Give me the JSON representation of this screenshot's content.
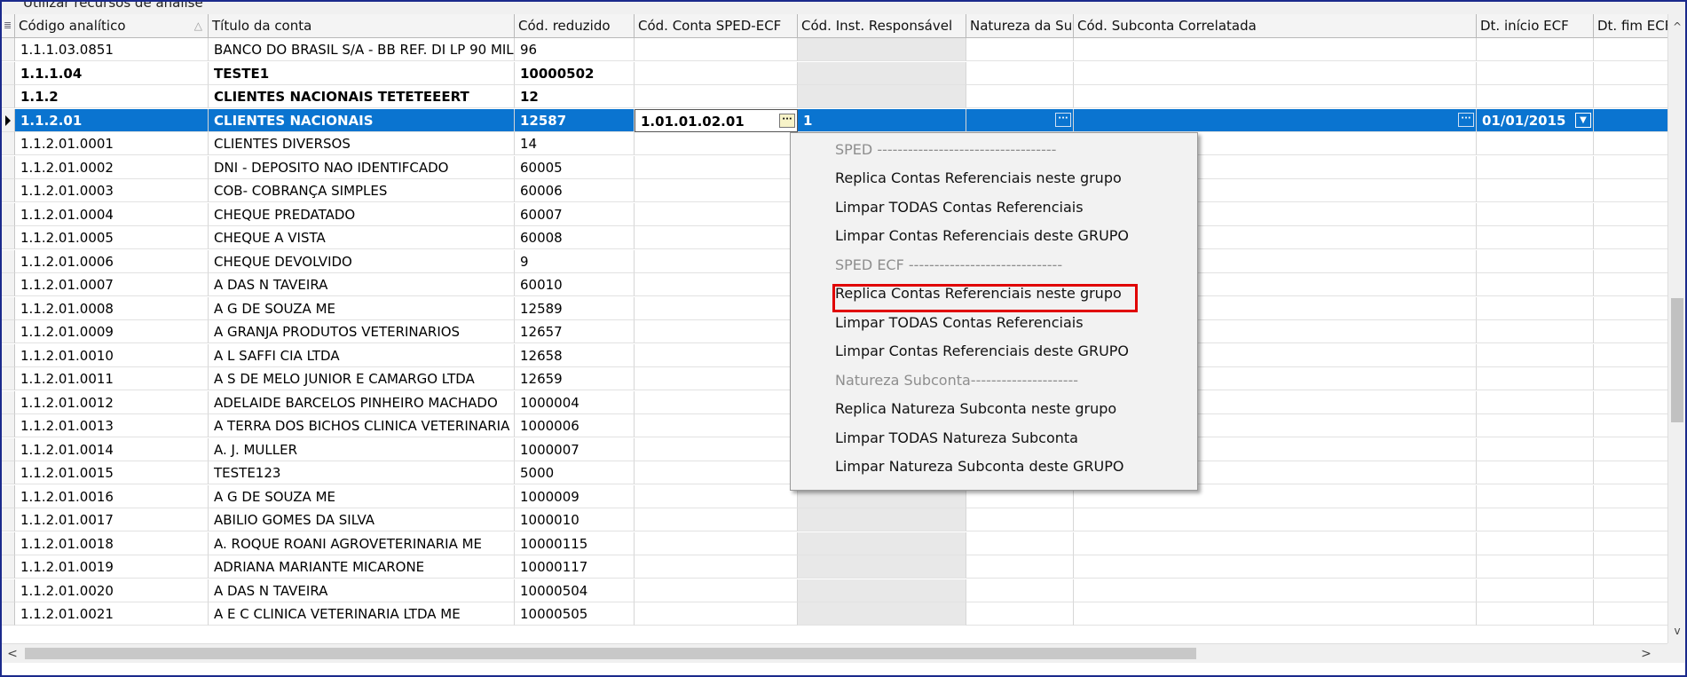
{
  "top_strip_label": "Utilizar recursos de análise",
  "columns": [
    {
      "label": "Código analítico"
    },
    {
      "label": "Título da conta"
    },
    {
      "label": "Cód. reduzido"
    },
    {
      "label": "Cód. Conta SPED-ECF"
    },
    {
      "label": "Cód. Inst. Responsável"
    },
    {
      "label": "Natureza da Su"
    },
    {
      "label": "Cód. Subconta Correlatada"
    },
    {
      "label": "Dt. início ECF"
    },
    {
      "label": "Dt. fim ECF"
    }
  ],
  "rows": [
    {
      "codigo": "1.1.1.03.0851",
      "titulo": "BANCO DO BRASIL S/A - BB REF. DI LP 90 MIL",
      "reduzido": "96",
      "style": "normal"
    },
    {
      "codigo": "1.1.1.04",
      "titulo": "TESTE1",
      "reduzido": "10000502",
      "style": "bold"
    },
    {
      "codigo": "1.1.2",
      "titulo": "CLIENTES NACIONAIS TETETEEERT",
      "reduzido": "12",
      "style": "bold"
    },
    {
      "codigo": "1.1.2.01",
      "titulo": "CLIENTES NACIONAIS",
      "reduzido": "12587",
      "sped": "1.01.01.02.01",
      "inst": "1",
      "dt_inicio": "01/01/2015",
      "style": "selected"
    },
    {
      "codigo": "1.1.2.01.0001",
      "titulo": "CLIENTES DIVERSOS",
      "reduzido": "14",
      "style": "normal"
    },
    {
      "codigo": "1.1.2.01.0002",
      "titulo": "DNI - DEPOSITO NAO IDENTIFCADO",
      "reduzido": "60005",
      "style": "normal"
    },
    {
      "codigo": "1.1.2.01.0003",
      "titulo": "COB- COBRANÇA SIMPLES",
      "reduzido": "60006",
      "style": "normal"
    },
    {
      "codigo": "1.1.2.01.0004",
      "titulo": "CHEQUE PREDATADO",
      "reduzido": "60007",
      "style": "normal"
    },
    {
      "codigo": "1.1.2.01.0005",
      "titulo": "CHEQUE A VISTA",
      "reduzido": "60008",
      "style": "normal"
    },
    {
      "codigo": "1.1.2.01.0006",
      "titulo": "CHEQUE DEVOLVIDO",
      "reduzido": "9",
      "style": "normal"
    },
    {
      "codigo": "1.1.2.01.0007",
      "titulo": "A DAS N TAVEIRA",
      "reduzido": "60010",
      "style": "normal"
    },
    {
      "codigo": "1.1.2.01.0008",
      "titulo": "A G DE SOUZA ME",
      "reduzido": "12589",
      "style": "normal"
    },
    {
      "codigo": "1.1.2.01.0009",
      "titulo": "A GRANJA PRODUTOS VETERINARIOS",
      "reduzido": "12657",
      "style": "normal"
    },
    {
      "codigo": "1.1.2.01.0010",
      "titulo": "A L SAFFI CIA LTDA",
      "reduzido": "12658",
      "style": "normal"
    },
    {
      "codigo": "1.1.2.01.0011",
      "titulo": "A S DE MELO JUNIOR E CAMARGO LTDA",
      "reduzido": "12659",
      "style": "normal"
    },
    {
      "codigo": "1.1.2.01.0012",
      "titulo": "ADELAIDE BARCELOS PINHEIRO MACHADO",
      "reduzido": "1000004",
      "style": "normal"
    },
    {
      "codigo": "1.1.2.01.0013",
      "titulo": "A TERRA DOS BICHOS CLINICA VETERINARIA",
      "reduzido": "1000006",
      "style": "normal"
    },
    {
      "codigo": "1.1.2.01.0014",
      "titulo": "A. J. MULLER",
      "reduzido": "1000007",
      "style": "normal"
    },
    {
      "codigo": "1.1.2.01.0015",
      "titulo": "TESTE123",
      "reduzido": "5000",
      "style": "normal"
    },
    {
      "codigo": "1.1.2.01.0016",
      "titulo": "A G DE SOUZA ME",
      "reduzido": "1000009",
      "style": "normal"
    },
    {
      "codigo": "1.1.2.01.0017",
      "titulo": "ABILIO GOMES DA SILVA",
      "reduzido": "1000010",
      "style": "normal"
    },
    {
      "codigo": "1.1.2.01.0018",
      "titulo": "A. ROQUE ROANI AGROVETERINARIA ME",
      "reduzido": "10000115",
      "style": "normal"
    },
    {
      "codigo": "1.1.2.01.0019",
      "titulo": "ADRIANA MARIANTE MICARONE",
      "reduzido": "10000117",
      "style": "normal"
    },
    {
      "codigo": "1.1.2.01.0020",
      "titulo": "A DAS N TAVEIRA",
      "reduzido": "10000504",
      "style": "normal"
    },
    {
      "codigo": "1.1.2.01.0021",
      "titulo": "A E C CLINICA VETERINARIA LTDA ME",
      "reduzido": "10000505",
      "style": "normal"
    }
  ],
  "context_menu": [
    {
      "label": "SPED -----------------------------------",
      "type": "separator"
    },
    {
      "label": "Replica Contas Referenciais neste grupo",
      "type": "item"
    },
    {
      "label": "Limpar TODAS Contas Referenciais",
      "type": "item"
    },
    {
      "label": "Limpar Contas Referenciais deste GRUPO",
      "type": "item"
    },
    {
      "label": "SPED ECF ------------------------------",
      "type": "separator"
    },
    {
      "label": "Replica Contas Referenciais neste grupo",
      "type": "item",
      "highlighted": true
    },
    {
      "label": "Limpar TODAS Contas Referenciais",
      "type": "item"
    },
    {
      "label": "Limpar Contas Referenciais deste GRUPO",
      "type": "item"
    },
    {
      "label": "Natureza Subconta---------------------",
      "type": "separator"
    },
    {
      "label": "Replica Natureza Subconta neste grupo",
      "type": "item"
    },
    {
      "label": "Limpar TODAS Natureza Subconta",
      "type": "item"
    },
    {
      "label": "Limpar Natureza Subconta deste GRUPO",
      "type": "item"
    }
  ],
  "colors": {
    "selection": "#0a74d0",
    "highlight_border": "#e00000",
    "window_border": "#1b2a8c",
    "disabled_column": "#e8e8e8"
  },
  "icons": {
    "ellipsis_button": "ellipsis-icon",
    "dropdown_button": "chevron-down-icon",
    "row_pointer": "row-pointer-icon",
    "grid_menu": "grid-menu-icon",
    "sort": "sort-arrow-icon"
  }
}
